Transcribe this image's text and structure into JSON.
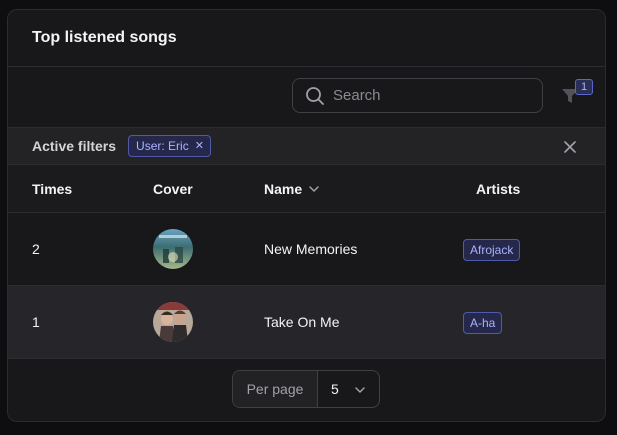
{
  "card": {
    "title": "Top listened songs"
  },
  "toolbar": {
    "search_placeholder": "Search",
    "search_value": "",
    "filter_icon": "funnel-icon",
    "filter_count": "1"
  },
  "active_filters": {
    "label": "Active filters",
    "chips": [
      {
        "label": "User: Eric",
        "remove_icon": "close-icon"
      }
    ],
    "clear_icon": "close-icon"
  },
  "table": {
    "columns": {
      "times": "Times",
      "cover": "Cover",
      "name": "Name",
      "artists": "Artists"
    },
    "sort_icon": "chevron-down-icon",
    "rows": [
      {
        "times": "2",
        "cover_icon": "album-cover-image",
        "name": "New Memories",
        "artist": "Afrojack"
      },
      {
        "times": "1",
        "cover_icon": "album-cover-image",
        "name": "Take On Me",
        "artist": "A-ha"
      }
    ]
  },
  "pagination": {
    "label": "Per page",
    "value": "5",
    "chevron_icon": "chevron-down-icon"
  },
  "colors": {
    "background": "#0e0e10",
    "card": "#18181b",
    "accent": "#a9b3ff",
    "tag_border": "#4f5aa8"
  }
}
